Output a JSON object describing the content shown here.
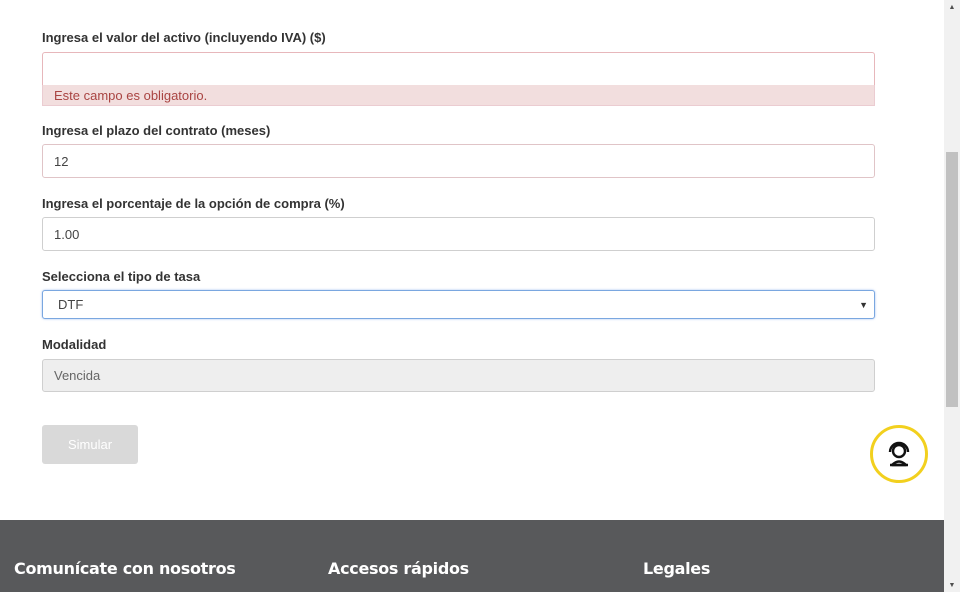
{
  "form": {
    "asset_value": {
      "label": "Ingresa el valor del activo (incluyendo IVA) ($)",
      "value": "",
      "error": "Este campo es obligatorio."
    },
    "term": {
      "label": "Ingresa el plazo del contrato (meses)",
      "value": "12"
    },
    "purchase_option": {
      "label": "Ingresa el porcentaje de la opción de compra (%)",
      "value": "1.00"
    },
    "rate_type": {
      "label": "Selecciona el tipo de tasa",
      "selected": "DTF"
    },
    "modality": {
      "label": "Modalidad",
      "value": "Vencida"
    },
    "submit_label": "Simular"
  },
  "footer": {
    "contact": "Comunícate con nosotros",
    "quick_access": "Accesos rápidos",
    "legal": "Legales"
  },
  "colors": {
    "footer_bg": "#58595b",
    "error_bg": "#f2dede",
    "chat_ring": "#f2d01e"
  },
  "icons": {
    "chat": "support-agent-icon",
    "select_arrow": "caret-down-icon"
  }
}
